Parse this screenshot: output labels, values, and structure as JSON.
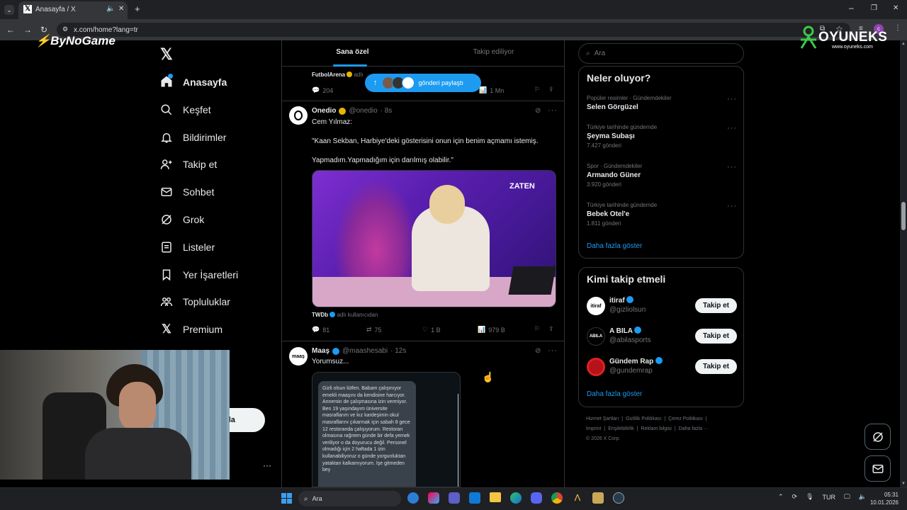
{
  "browser": {
    "tab_title": "Anasayfa / X",
    "url": "x.com/home?lang=tr"
  },
  "overlay": {
    "bynogame": "ByNoGame",
    "oyuneks": "OYUNEKS",
    "oyuneks_sub": "www.oyuneks.com"
  },
  "sidebar": {
    "items": [
      {
        "label": "Anasayfa"
      },
      {
        "label": "Keşfet"
      },
      {
        "label": "Bildirimler"
      },
      {
        "label": "Takip et"
      },
      {
        "label": "Sohbet"
      },
      {
        "label": "Grok"
      },
      {
        "label": "Listeler"
      },
      {
        "label": "Yer İşaretleri"
      },
      {
        "label": "Topluluklar"
      },
      {
        "label": "Premium"
      }
    ],
    "post_button_partial": "nla",
    "more": "···"
  },
  "feed": {
    "tabs": [
      {
        "label": "Sana özel"
      },
      {
        "label": "Takip ediliyor"
      }
    ],
    "new_posts_pill": "gönderi paylaştı",
    "post0": {
      "source": "FutbolArena",
      "source_suffix": "adlı",
      "replies": "204",
      "views": "1 Mn"
    },
    "post1": {
      "name": "Onedio",
      "handle": "@onedio",
      "time": "· 8s",
      "line1": "Cem Yılmaz:",
      "line2": "\"Kaan Sekban, Harbiye'deki gösterisini onun için benim açmamı istemiş.",
      "line3": "Yapmadım.Yapmadığım için darılmış olabilir.\"",
      "media_watermark": "ZATEN",
      "source": "TWDb",
      "source_suffix": "adlı kullanıcıdan",
      "replies": "81",
      "reposts": "75",
      "likes": "1 B",
      "views": "979 B"
    },
    "post2": {
      "avatar_text": "maaş",
      "name": "Maaş",
      "handle": "@maashesabi",
      "time": "· 12s",
      "text": "Yorumsuz...",
      "image_text": "Gizli olsun lütfen. Babam çalışmıyor emekli maaşını da kendisine harcıyor. Annemin de çalışmasına izin vermiyor. Ben 19 yaşındayım üniversite masraflarım ve kız kardeşimin okul masraflarını çıkarmak için sabah 8 gece 12 restoranda çalışıyorum. Restoran olmasına rağmen günde bir defa yemek veriliyor o da doyurucu değil. Personel olmadığı için 2 haftada 1 izin kullanabiliyoruz o günde yorgunluktan yataktan kalkamıyorum. İşe gitmeden bey"
    }
  },
  "right": {
    "search_placeholder": "Ara",
    "trends_title": "Neler oluyor?",
    "trends": [
      {
        "context": "Popüler resimler · Gündemdekiler",
        "name": "Selen Görgüzel",
        "count": ""
      },
      {
        "context": "Türkiye tarihinde gündemde",
        "name": "Şeyma Subaşı",
        "count": "7.427 gönderi"
      },
      {
        "context": "Spor · Gündemdekiler",
        "name": "Armando Güner",
        "count": "3.920 gönderi"
      },
      {
        "context": "Türkiye tarihinde gündemde",
        "name": "Bebek Otel'e",
        "count": "1.811 gönderi"
      }
    ],
    "show_more": "Daha fazla göster",
    "who_title": "Kimi takip etmeli",
    "who": [
      {
        "name": "itiraf",
        "handle": "@gizliolsun",
        "button": "Takip et",
        "avatar": "itiraf"
      },
      {
        "name": "A BILA",
        "handle": "@abilasports",
        "button": "Takip et",
        "avatar": "ABILA"
      },
      {
        "name": "Gündem Rap",
        "handle": "@gundemrap",
        "button": "Takip et",
        "avatar": ""
      }
    ],
    "who_show_more": "Daha fazla göster",
    "footer": {
      "line1": [
        "Hizmet Şartları",
        "Gizlilik Politikası",
        "Çerez Politikası"
      ],
      "line2": [
        "İmprint",
        "Erişilebilirlik",
        "Reklam bilgisi",
        "Daha fazla ···"
      ],
      "copyright": "© 2026 X Corp."
    }
  },
  "taskbar": {
    "search": "Ara",
    "lang": "TUR",
    "time": "05:31",
    "date": "10.01.2026"
  },
  "colors": {
    "accent": "#1d9bf0",
    "background": "#000000",
    "border": "#2f3336",
    "text": "#e7e9ea",
    "muted": "#71767b"
  }
}
